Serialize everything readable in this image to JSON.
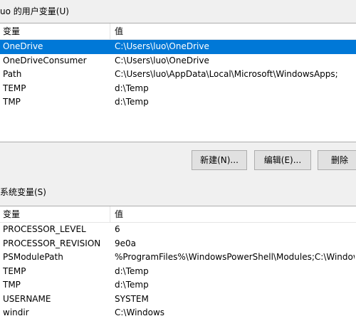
{
  "user_vars": {
    "label": "uo 的用户变量(U)",
    "col_name": "变量",
    "col_value": "值",
    "rows": [
      {
        "name": "OneDrive",
        "value": "C:\\Users\\luo\\OneDrive"
      },
      {
        "name": "OneDriveConsumer",
        "value": "C:\\Users\\luo\\OneDrive"
      },
      {
        "name": "Path",
        "value": "C:\\Users\\luo\\AppData\\Local\\Microsoft\\WindowsApps;"
      },
      {
        "name": "TEMP",
        "value": "d:\\Temp"
      },
      {
        "name": "TMP",
        "value": "d:\\Temp"
      }
    ],
    "buttons": {
      "new": "新建(N)...",
      "edit": "编辑(E)...",
      "delete": "删除"
    }
  },
  "system_vars": {
    "label": "系统变量(S)",
    "col_name": "变量",
    "col_value": "值",
    "rows": [
      {
        "name": "PROCESSOR_LEVEL",
        "value": "6"
      },
      {
        "name": "PROCESSOR_REVISION",
        "value": "9e0a"
      },
      {
        "name": "PSModulePath",
        "value": "%ProgramFiles%\\WindowsPowerShell\\Modules;C:\\Windows\\..."
      },
      {
        "name": "TEMP",
        "value": "d:\\Temp"
      },
      {
        "name": "TMP",
        "value": "d:\\Temp"
      },
      {
        "name": "USERNAME",
        "value": "SYSTEM"
      },
      {
        "name": "windir",
        "value": "C:\\Windows"
      }
    ]
  }
}
